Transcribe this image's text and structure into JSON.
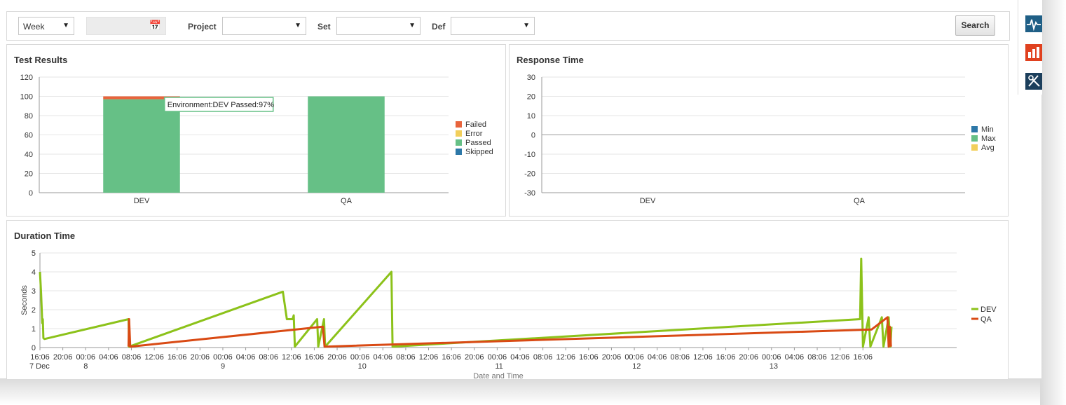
{
  "filters": {
    "period": "Week",
    "project_label": "Project",
    "set_label": "Set",
    "def_label": "Def",
    "search_label": "Search"
  },
  "sidebar": {
    "icons": [
      "activity-monitor-icon",
      "bar-chart-icon",
      "tools-icon"
    ]
  },
  "colors": {
    "failed": "#e8643c",
    "error": "#f2cf5b",
    "passed": "#66c086",
    "skipped": "#2d78a8",
    "min": "#2d78a8",
    "max": "#66c086",
    "avg": "#f2cf5b",
    "dev_line": "#8cc21a",
    "qa_line": "#d94a14"
  },
  "chart_data": [
    {
      "type": "bar",
      "title": "Test Results",
      "categories": [
        "DEV",
        "QA"
      ],
      "stacked": true,
      "ylim": [
        0,
        120
      ],
      "yticks": [
        0,
        20,
        40,
        60,
        80,
        100,
        120
      ],
      "grid": true,
      "legend_position": "right",
      "series": [
        {
          "name": "Failed",
          "values": [
            3,
            0
          ]
        },
        {
          "name": "Error",
          "values": [
            0,
            0
          ]
        },
        {
          "name": "Passed",
          "values": [
            97,
            100
          ]
        },
        {
          "name": "Skipped",
          "values": [
            0,
            0
          ]
        }
      ],
      "tooltip": "Environment:DEV Passed:97%"
    },
    {
      "type": "bar",
      "title": "Response Time",
      "categories": [
        "DEV",
        "QA"
      ],
      "ylim": [
        -30,
        30
      ],
      "yticks": [
        -30,
        -20,
        -10,
        0,
        10,
        20,
        30
      ],
      "grid": true,
      "legend_position": "right",
      "series": [
        {
          "name": "Min",
          "values": [
            0,
            0
          ]
        },
        {
          "name": "Max",
          "values": [
            0,
            0
          ]
        },
        {
          "name": "Avg",
          "values": [
            0,
            0
          ]
        }
      ]
    },
    {
      "type": "line",
      "title": "Duration Time",
      "ylabel": "Seconds",
      "xlabel": "Date and Time",
      "ylim": [
        0,
        5
      ],
      "yticks": [
        0,
        1,
        2,
        3,
        4,
        5
      ],
      "xlim": [
        0,
        160.4
      ],
      "grid": true,
      "legend_position": "right",
      "time_ticks": [
        "16:06",
        "20:06",
        "00:06",
        "04:06",
        "08:06",
        "12:06",
        "16:06",
        "20:06",
        "00:06",
        "04:06",
        "08:06",
        "12:06",
        "16:06",
        "20:06",
        "00:06",
        "04:06",
        "08:06",
        "12:06",
        "16:06",
        "20:06",
        "00:06",
        "04:06",
        "08:06",
        "12:06",
        "16:06",
        "20:06",
        "00:06",
        "04:06",
        "08:06",
        "12:06",
        "16:06",
        "20:06",
        "00:06",
        "04:06",
        "08:06",
        "12:06",
        "16:06"
      ],
      "date_labels": [
        {
          "label": "7 Dec",
          "at": 0
        },
        {
          "label": "8",
          "at": 8
        },
        {
          "label": "9",
          "at": 32
        },
        {
          "label": "10",
          "at": 56
        },
        {
          "label": "11",
          "at": 80
        },
        {
          "label": "12",
          "at": 104
        },
        {
          "label": "13",
          "at": 128
        }
      ],
      "series": [
        {
          "name": "DEV",
          "points": [
            [
              0,
              4.0
            ],
            [
              0.2,
              2.9
            ],
            [
              0.4,
              1.3
            ],
            [
              0.5,
              1.5
            ],
            [
              0.6,
              0.5
            ],
            [
              0.8,
              0.45
            ],
            [
              15.5,
              1.5
            ],
            [
              15.6,
              0.05
            ],
            [
              42.5,
              2.95
            ],
            [
              43.2,
              1.5
            ],
            [
              44.2,
              1.5
            ],
            [
              44.4,
              1.7
            ],
            [
              44.6,
              0.05
            ],
            [
              48.5,
              1.5
            ],
            [
              48.7,
              0.05
            ],
            [
              49.7,
              1.5
            ],
            [
              49.9,
              0.05
            ],
            [
              61.5,
              4.0
            ],
            [
              61.7,
              0.05
            ],
            [
              143.5,
              1.5
            ],
            [
              143.7,
              4.7
            ],
            [
              144.0,
              0.05
            ],
            [
              145.0,
              1.6
            ],
            [
              145.3,
              0.05
            ],
            [
              147.3,
              1.6
            ],
            [
              147.6,
              0.05
            ],
            [
              148.5,
              1.6
            ],
            [
              148.8,
              0.05
            ],
            [
              149.0,
              1.1
            ]
          ]
        },
        {
          "name": "QA",
          "points": [
            [
              15.5,
              0.05
            ],
            [
              15.6,
              1.5
            ],
            [
              15.8,
              0.05
            ],
            [
              49.5,
              1.1
            ],
            [
              49.8,
              0.05
            ],
            [
              145.5,
              0.95
            ],
            [
              148.3,
              1.6
            ],
            [
              148.5,
              0.05
            ],
            [
              148.7,
              1.1
            ],
            [
              148.9,
              0.05
            ]
          ]
        }
      ]
    }
  ]
}
